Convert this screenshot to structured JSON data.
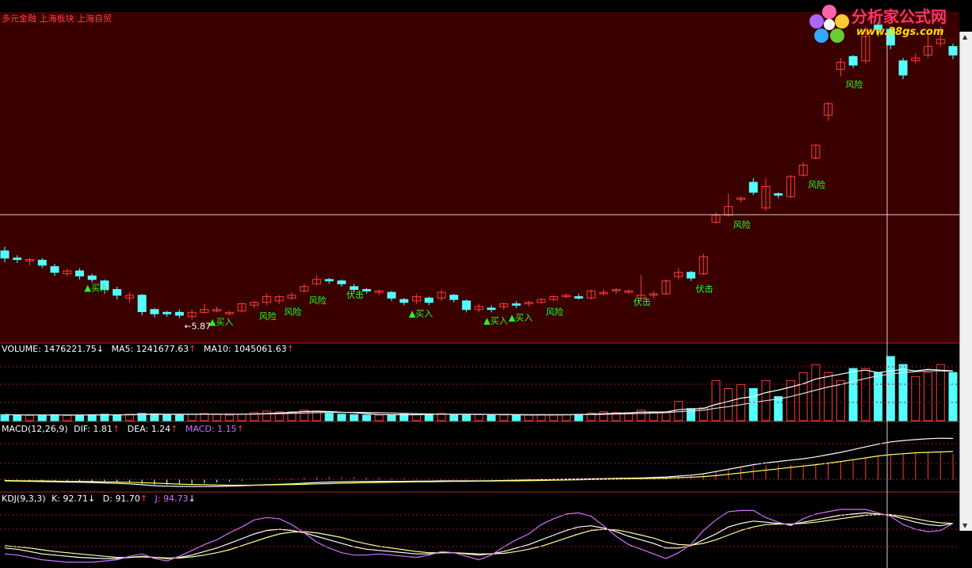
{
  "stock_names": "多元金融 上海板块 上海自贸",
  "logo": {
    "title": "分析家公式网",
    "url": "www.88gs.com"
  },
  "volume_header": {
    "label": "VOLUME: 1476221.75",
    "ma5": "MA5: 1241677.63",
    "ma10": "MA10: 1045061.63"
  },
  "macd_header": {
    "label": "MACD(12,26,9)",
    "dif": "DIF: 1.81",
    "dea": "DEA: 1.24",
    "macd": "MACD: 1.15"
  },
  "kdj_header": {
    "label": "KDJ(9,3,3)",
    "k": "K: 92.71",
    "d": "D: 91.70",
    "j": "J: 94.73"
  },
  "colors": {
    "up": "#ff3b3b",
    "down": "#54ffff",
    "white": "#ffffff",
    "magenta": "#d070ff",
    "bg_main": "#3a0000",
    "green": "#22ff22",
    "grid": "#9b1a1a"
  },
  "chart_data": [
    {
      "type": "candlestick",
      "candles": [
        [
          6.8,
          6.7,
          6.86,
          6.64
        ],
        [
          6.7,
          6.68,
          6.74,
          6.63
        ],
        [
          6.66,
          6.68,
          6.7,
          6.6
        ],
        [
          6.67,
          6.6,
          6.7,
          6.56
        ],
        [
          6.58,
          6.5,
          6.62,
          6.45
        ],
        [
          6.48,
          6.52,
          6.55,
          6.44
        ],
        [
          6.52,
          6.45,
          6.56,
          6.4
        ],
        [
          6.45,
          6.4,
          6.48,
          6.36
        ],
        [
          6.38,
          6.26,
          6.4,
          6.2
        ],
        [
          6.26,
          6.18,
          6.3,
          6.12
        ],
        [
          6.14,
          6.18,
          6.22,
          6.08
        ],
        [
          6.18,
          5.95,
          6.2,
          5.9
        ],
        [
          5.98,
          5.92,
          6.0,
          5.87
        ],
        [
          5.94,
          5.92,
          5.96,
          5.88
        ],
        [
          5.94,
          5.9,
          5.98,
          5.86
        ],
        [
          5.88,
          5.94,
          5.98,
          5.84
        ],
        [
          5.94,
          5.98,
          6.06,
          5.92
        ],
        [
          5.96,
          5.98,
          6.02,
          5.94
        ],
        [
          5.92,
          5.94,
          5.96,
          5.9
        ],
        [
          5.96,
          6.06,
          6.08,
          5.94
        ],
        [
          6.04,
          6.08,
          6.1,
          6.0
        ],
        [
          6.08,
          6.16,
          6.2,
          6.04
        ],
        [
          6.1,
          6.16,
          6.18,
          6.06
        ],
        [
          6.14,
          6.18,
          6.22,
          6.12
        ],
        [
          6.24,
          6.3,
          6.34,
          6.22
        ],
        [
          6.34,
          6.4,
          6.46,
          6.32
        ],
        [
          6.4,
          6.38,
          6.42,
          6.34
        ],
        [
          6.38,
          6.34,
          6.4,
          6.3
        ],
        [
          6.3,
          6.26,
          6.34,
          6.22
        ],
        [
          6.26,
          6.24,
          6.28,
          6.2
        ],
        [
          6.22,
          6.24,
          6.26,
          6.18
        ],
        [
          6.22,
          6.14,
          6.24,
          6.1
        ],
        [
          6.12,
          6.08,
          6.14,
          6.04
        ],
        [
          6.1,
          6.16,
          6.2,
          6.06
        ],
        [
          6.14,
          6.08,
          6.16,
          6.04
        ],
        [
          6.14,
          6.22,
          6.26,
          6.1
        ],
        [
          6.18,
          6.12,
          6.2,
          6.08
        ],
        [
          6.1,
          5.98,
          6.12,
          5.94
        ],
        [
          5.98,
          6.02,
          6.06,
          5.94
        ],
        [
          6.0,
          5.98,
          6.04,
          5.94
        ],
        [
          6.02,
          6.06,
          6.08,
          5.98
        ],
        [
          6.06,
          6.04,
          6.1,
          6.0
        ],
        [
          6.06,
          6.08,
          6.1,
          6.02
        ],
        [
          6.08,
          6.12,
          6.14,
          6.06
        ],
        [
          6.12,
          6.16,
          6.18,
          6.1
        ],
        [
          6.16,
          6.18,
          6.2,
          6.14
        ],
        [
          6.16,
          6.14,
          6.2,
          6.12
        ],
        [
          6.14,
          6.24,
          6.26,
          6.12
        ],
        [
          6.2,
          6.22,
          6.26,
          6.18
        ],
        [
          6.24,
          6.26,
          6.28,
          6.2
        ],
        [
          6.22,
          6.24,
          6.26,
          6.2
        ],
        [
          6.14,
          6.18,
          6.46,
          6.1
        ],
        [
          6.18,
          6.2,
          6.24,
          6.14
        ],
        [
          6.2,
          6.38,
          6.4,
          6.18
        ],
        [
          6.44,
          6.5,
          6.56,
          6.4
        ],
        [
          6.5,
          6.42,
          6.52,
          6.38
        ],
        [
          6.48,
          6.72,
          6.76,
          6.46
        ],
        [
          7.2,
          7.3,
          7.34,
          7.18
        ],
        [
          7.3,
          7.42,
          7.6,
          7.28
        ],
        [
          7.52,
          7.54,
          7.56,
          7.48
        ],
        [
          7.76,
          7.62,
          7.82,
          7.58
        ],
        [
          7.4,
          7.7,
          7.82,
          7.36
        ],
        [
          7.6,
          7.58,
          7.62,
          7.54
        ],
        [
          7.56,
          7.84,
          7.86,
          7.54
        ],
        [
          7.86,
          8.0,
          8.04,
          7.84
        ],
        [
          8.1,
          8.28,
          8.3,
          8.08
        ],
        [
          8.7,
          8.86,
          8.88,
          8.62
        ],
        [
          9.34,
          9.44,
          9.5,
          9.24
        ],
        [
          9.52,
          9.4,
          9.54,
          9.36
        ],
        [
          9.46,
          9.8,
          9.94,
          9.42
        ],
        [
          9.96,
          9.9,
          10.0,
          9.8
        ],
        [
          9.9,
          9.68,
          9.94,
          9.62
        ],
        [
          9.46,
          9.26,
          9.5,
          9.2
        ],
        [
          9.46,
          9.5,
          9.56,
          9.42
        ],
        [
          9.54,
          9.66,
          9.82,
          9.5
        ],
        [
          9.7,
          9.76,
          9.94,
          9.66
        ],
        [
          9.66,
          9.54,
          9.7,
          9.48
        ]
      ],
      "ylim": [
        5.6,
        10.0
      ],
      "annotations": [
        {
          "index": 6,
          "text": "▲买入"
        },
        {
          "index": 14,
          "text": "←5.87"
        },
        {
          "index": 16,
          "text": "▲买入"
        },
        {
          "index": 20,
          "text": "风险"
        },
        {
          "index": 22,
          "text": "风险"
        },
        {
          "index": 24,
          "text": "风险"
        },
        {
          "index": 27,
          "text": "伏击"
        },
        {
          "index": 32,
          "text": "▲买入"
        },
        {
          "index": 38,
          "text": "▲买入"
        },
        {
          "index": 40,
          "text": "▲买入"
        },
        {
          "index": 43,
          "text": "风险"
        },
        {
          "index": 50,
          "text": "伏击"
        },
        {
          "index": 55,
          "text": "伏击"
        },
        {
          "index": 58,
          "text": "风险"
        },
        {
          "index": 64,
          "text": "风险"
        },
        {
          "index": 67,
          "text": "风险"
        }
      ]
    },
    {
      "type": "bar",
      "name": "VOLUME",
      "values": [
        1.5,
        1.4,
        1.3,
        1.4,
        1.5,
        1.3,
        1.4,
        1.5,
        1.6,
        1.5,
        1.6,
        1.8,
        1.7,
        1.5,
        1.4,
        1.6,
        1.8,
        1.5,
        1.4,
        1.6,
        2.0,
        2.4,
        2.2,
        2.2,
        2.6,
        2.4,
        1.8,
        1.6,
        1.5,
        1.4,
        1.4,
        1.5,
        1.6,
        1.5,
        1.7,
        1.8,
        1.5,
        1.6,
        1.5,
        1.4,
        1.4,
        1.3,
        1.4,
        1.5,
        1.5,
        1.5,
        1.6,
        1.9,
        2.2,
        2.0,
        2.0,
        2.6,
        2.0,
        2.2,
        4.8,
        3.0,
        3.2,
        10.0,
        8.0,
        9.0,
        8.0,
        10.0,
        6.0,
        10.0,
        12.0,
        14.0,
        12.0,
        10.0,
        13.0,
        13.0,
        12.0,
        16.0,
        14.0,
        11.0,
        12.0,
        14.0,
        12.0
      ],
      "ma5": [
        1.5,
        1.45,
        1.4,
        1.4,
        1.42,
        1.38,
        1.38,
        1.42,
        1.46,
        1.46,
        1.52,
        1.58,
        1.64,
        1.62,
        1.6,
        1.6,
        1.6,
        1.6,
        1.58,
        1.58,
        1.66,
        1.78,
        1.92,
        2.08,
        2.28,
        2.36,
        2.28,
        2.12,
        1.98,
        1.76,
        1.54,
        1.48,
        1.48,
        1.48,
        1.54,
        1.62,
        1.62,
        1.62,
        1.62,
        1.56,
        1.52,
        1.46,
        1.42,
        1.42,
        1.42,
        1.44,
        1.5,
        1.6,
        1.74,
        1.84,
        1.94,
        2.14,
        2.16,
        2.16,
        2.72,
        2.92,
        3.04,
        4.04,
        4.8,
        5.6,
        6.0,
        7.0,
        7.6,
        8.4,
        9.2,
        10.4,
        11.0,
        11.6,
        12.2,
        12.6,
        12.0,
        12.4,
        12.8,
        12.4,
        12.8,
        12.6,
        12.4
      ],
      "ma10": [
        1.5,
        1.45,
        1.4,
        1.4,
        1.42,
        1.4,
        1.4,
        1.42,
        1.44,
        1.45,
        1.46,
        1.5,
        1.54,
        1.55,
        1.54,
        1.56,
        1.58,
        1.6,
        1.6,
        1.6,
        1.62,
        1.68,
        1.72,
        1.8,
        1.9,
        2.0,
        2.04,
        2.06,
        2.08,
        2.06,
        2.0,
        1.92,
        1.84,
        1.76,
        1.66,
        1.6,
        1.56,
        1.56,
        1.56,
        1.56,
        1.56,
        1.54,
        1.52,
        1.52,
        1.5,
        1.5,
        1.5,
        1.52,
        1.56,
        1.64,
        1.7,
        1.8,
        1.9,
        2.0,
        2.24,
        2.4,
        2.6,
        3.1,
        3.5,
        4.0,
        4.5,
        5.0,
        5.4,
        6.0,
        6.8,
        7.6,
        8.4,
        9.0,
        9.8,
        10.5,
        11.2,
        11.6,
        12.0,
        12.2,
        12.4,
        12.4,
        12.3
      ],
      "ylim": [
        0,
        16
      ]
    },
    {
      "type": "line",
      "name": "MACD",
      "dif": [
        -0.05,
        -0.06,
        -0.07,
        -0.08,
        -0.09,
        -0.1,
        -0.11,
        -0.12,
        -0.14,
        -0.16,
        -0.18,
        -0.22,
        -0.26,
        -0.28,
        -0.29,
        -0.3,
        -0.3,
        -0.29,
        -0.28,
        -0.26,
        -0.24,
        -0.22,
        -0.2,
        -0.18,
        -0.15,
        -0.12,
        -0.1,
        -0.09,
        -0.08,
        -0.08,
        -0.07,
        -0.07,
        -0.07,
        -0.06,
        -0.06,
        -0.05,
        -0.05,
        -0.05,
        -0.05,
        -0.04,
        -0.03,
        -0.02,
        -0.01,
        0.0,
        0.01,
        0.02,
        0.03,
        0.04,
        0.05,
        0.06,
        0.07,
        0.08,
        0.1,
        0.12,
        0.16,
        0.2,
        0.26,
        0.36,
        0.46,
        0.56,
        0.66,
        0.74,
        0.8,
        0.86,
        0.92,
        1.0,
        1.1,
        1.2,
        1.32,
        1.44,
        1.56,
        1.66,
        1.72,
        1.76,
        1.8,
        1.82,
        1.81
      ],
      "dea": [
        -0.03,
        -0.04,
        -0.05,
        -0.05,
        -0.06,
        -0.07,
        -0.07,
        -0.08,
        -0.09,
        -0.1,
        -0.11,
        -0.13,
        -0.15,
        -0.17,
        -0.19,
        -0.21,
        -0.22,
        -0.23,
        -0.24,
        -0.24,
        -0.24,
        -0.23,
        -0.22,
        -0.21,
        -0.2,
        -0.18,
        -0.17,
        -0.15,
        -0.14,
        -0.13,
        -0.12,
        -0.11,
        -0.1,
        -0.09,
        -0.09,
        -0.08,
        -0.07,
        -0.07,
        -0.06,
        -0.06,
        -0.05,
        -0.05,
        -0.04,
        -0.03,
        -0.02,
        -0.01,
        0.0,
        0.01,
        0.02,
        0.03,
        0.04,
        0.05,
        0.06,
        0.07,
        0.09,
        0.11,
        0.14,
        0.18,
        0.24,
        0.3,
        0.36,
        0.42,
        0.48,
        0.54,
        0.6,
        0.66,
        0.73,
        0.8,
        0.88,
        0.96,
        1.04,
        1.1,
        1.14,
        1.18,
        1.2,
        1.22,
        1.24
      ],
      "ylim": [
        -0.5,
        2.0
      ]
    },
    {
      "type": "line",
      "name": "KDJ",
      "k": [
        30,
        28,
        24,
        20,
        18,
        16,
        14,
        13,
        12,
        12,
        14,
        16,
        14,
        12,
        14,
        18,
        24,
        30,
        38,
        46,
        54,
        60,
        62,
        60,
        56,
        50,
        44,
        38,
        32,
        28,
        26,
        24,
        22,
        20,
        20,
        22,
        22,
        20,
        18,
        20,
        24,
        30,
        36,
        44,
        52,
        60,
        66,
        68,
        64,
        58,
        50,
        44,
        38,
        30,
        30,
        34,
        44,
        54,
        66,
        72,
        76,
        74,
        72,
        70,
        74,
        78,
        82,
        86,
        88,
        90,
        88,
        86,
        80,
        74,
        70,
        68,
        72
      ],
      "d": [
        34,
        32,
        30,
        27,
        24,
        22,
        20,
        18,
        16,
        14,
        14,
        15,
        14,
        13,
        13,
        15,
        18,
        22,
        27,
        34,
        41,
        48,
        54,
        57,
        58,
        56,
        52,
        48,
        42,
        37,
        33,
        30,
        27,
        24,
        22,
        22,
        22,
        21,
        20,
        20,
        21,
        24,
        28,
        33,
        40,
        47,
        54,
        60,
        62,
        61,
        57,
        52,
        47,
        40,
        36,
        35,
        38,
        44,
        52,
        60,
        66,
        70,
        71,
        71,
        72,
        74,
        77,
        80,
        83,
        86,
        87,
        87,
        84,
        80,
        76,
        73,
        72
      ],
      "j": [
        20,
        18,
        14,
        10,
        8,
        6,
        6,
        6,
        8,
        10,
        16,
        20,
        12,
        8,
        16,
        26,
        36,
        44,
        56,
        66,
        78,
        82,
        80,
        70,
        56,
        40,
        30,
        22,
        18,
        18,
        20,
        18,
        16,
        14,
        18,
        24,
        22,
        16,
        10,
        18,
        32,
        44,
        54,
        70,
        80,
        88,
        90,
        84,
        68,
        50,
        36,
        28,
        20,
        12,
        22,
        36,
        60,
        78,
        92,
        94,
        94,
        82,
        74,
        68,
        80,
        88,
        92,
        96,
        96,
        96,
        90,
        84,
        70,
        62,
        58,
        60,
        72
      ],
      "ylim": [
        0,
        100
      ]
    }
  ]
}
